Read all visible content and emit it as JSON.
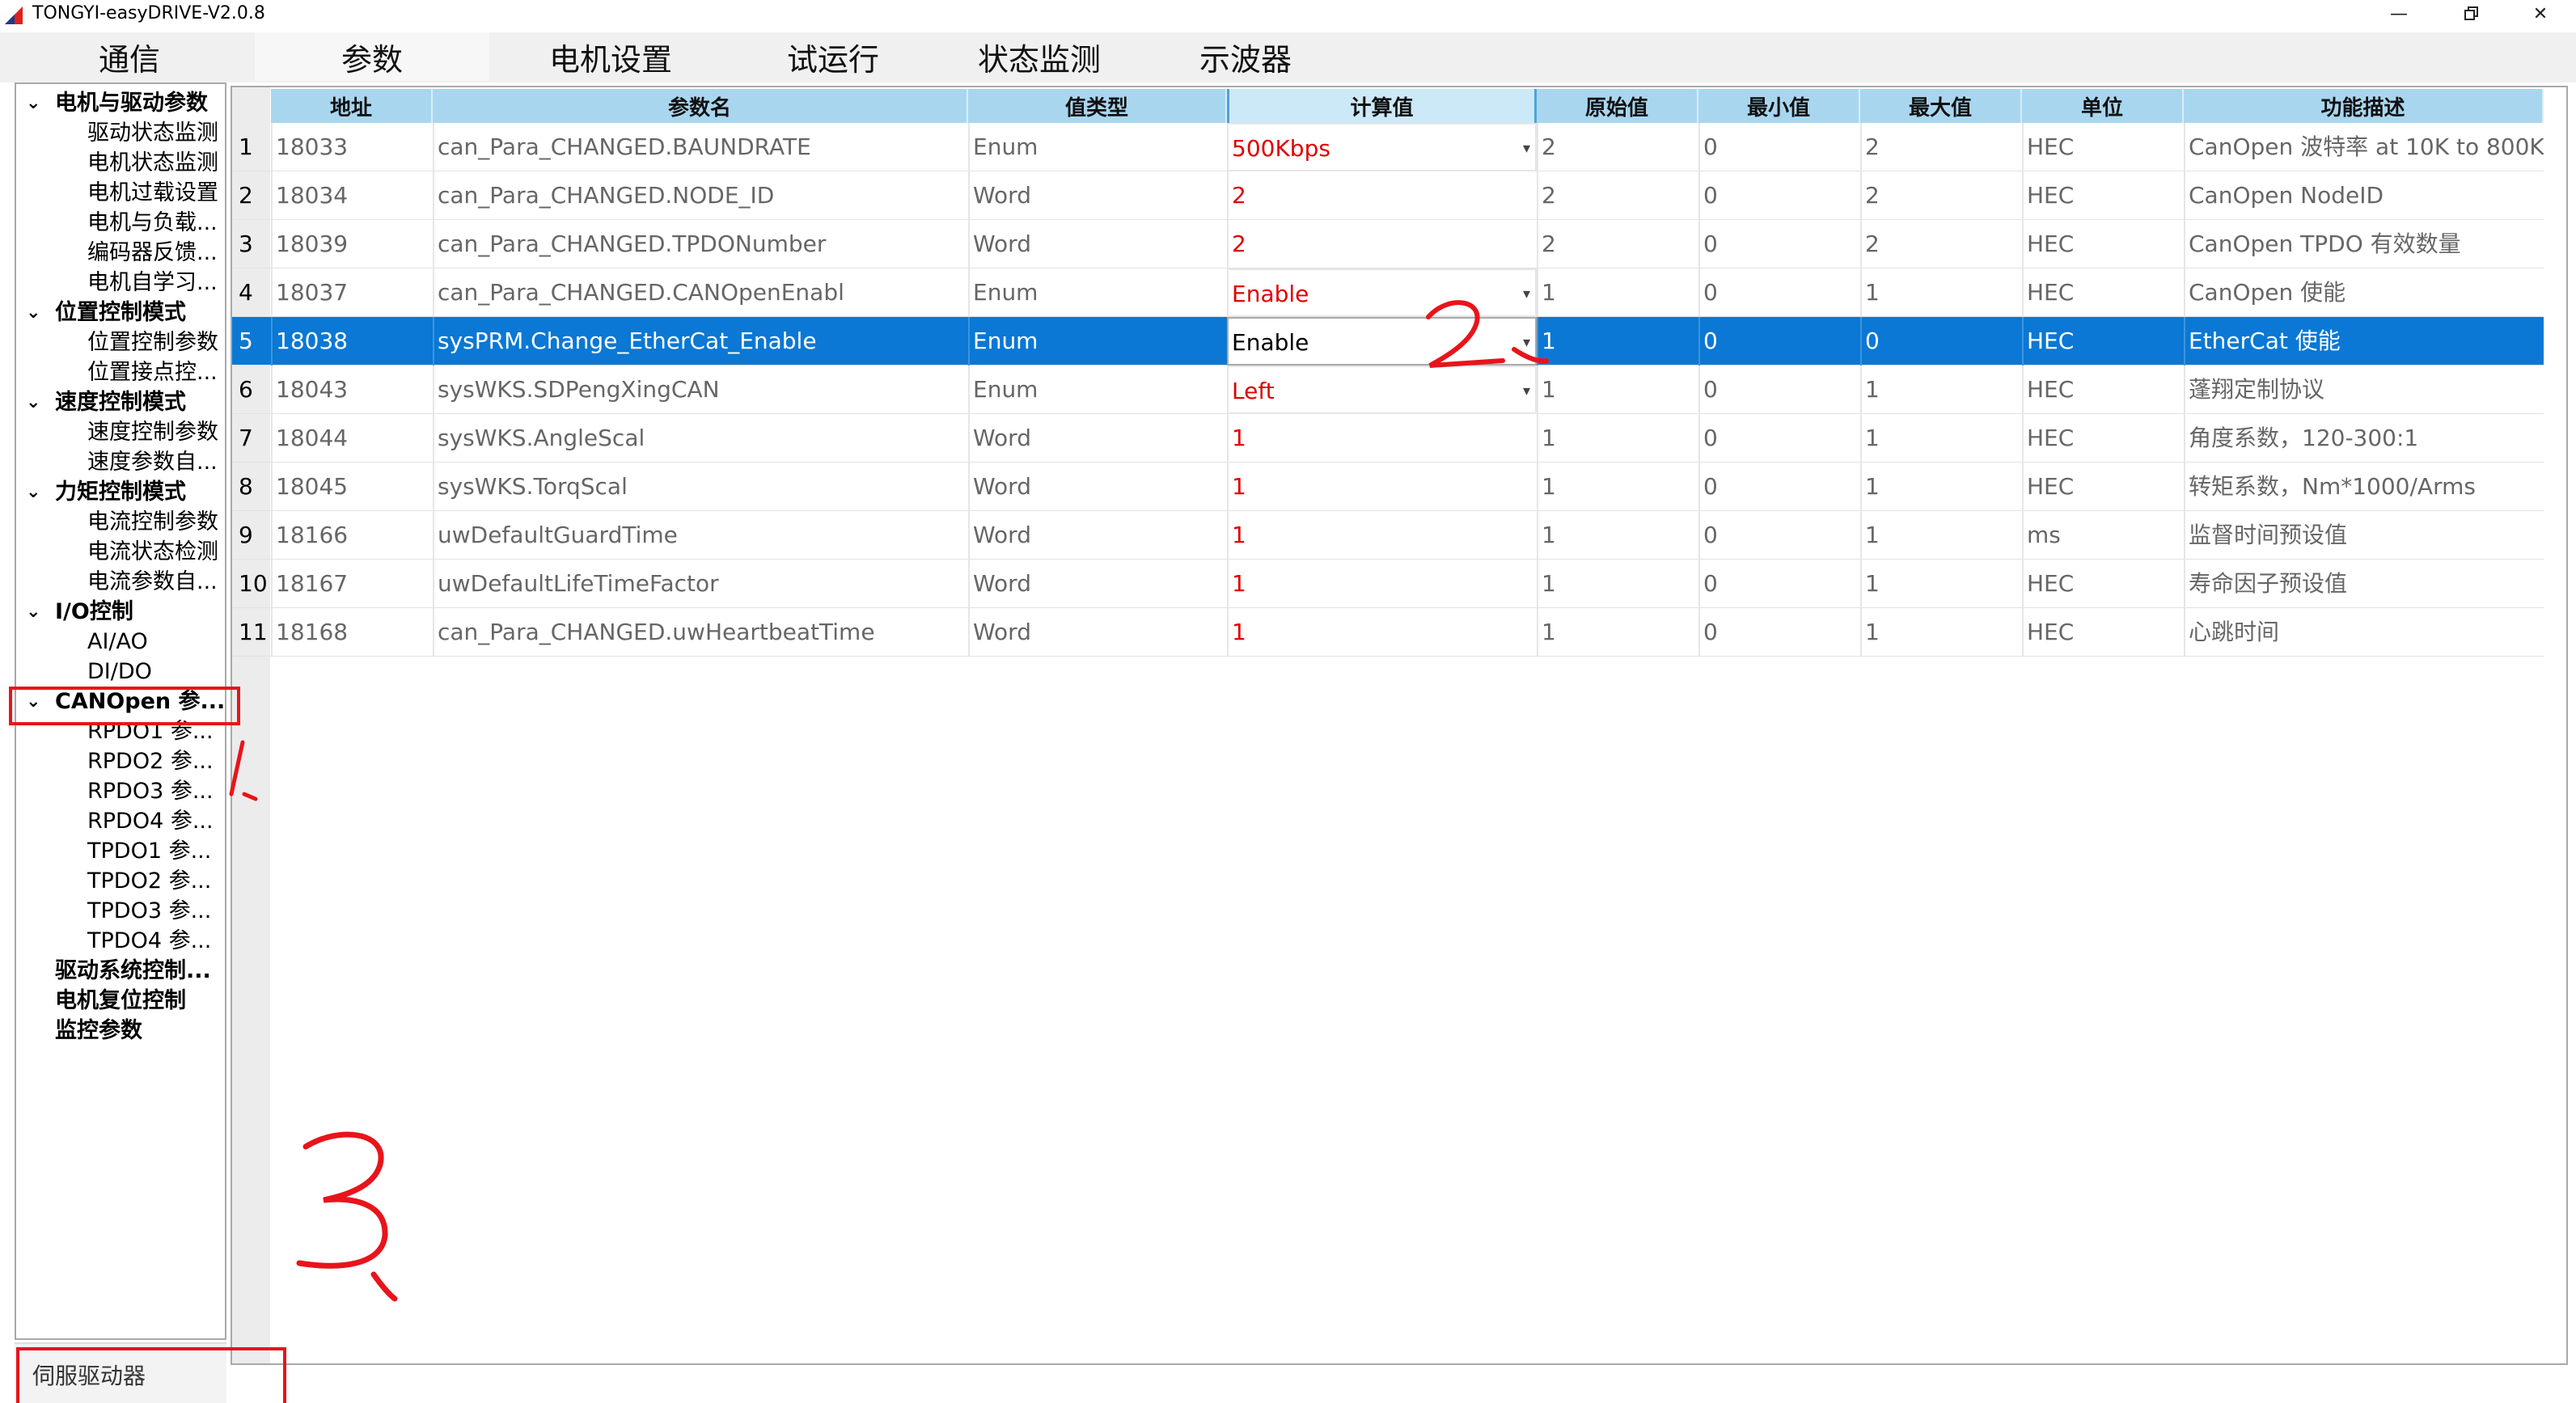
{
  "window": {
    "title": "TONGYI-easyDRIVE-V2.0.8"
  },
  "tabs": [
    "通信",
    "参数",
    "电机设置",
    "试运行",
    "状态监测",
    "示波器"
  ],
  "active_tab": "参数",
  "sidebar": {
    "items": [
      {
        "label": "电机与驱动参数",
        "group": true
      },
      {
        "label": "驱动状态监测"
      },
      {
        "label": "电机状态监测"
      },
      {
        "label": "电机过载设置"
      },
      {
        "label": "电机与负载..."
      },
      {
        "label": "编码器反馈..."
      },
      {
        "label": "电机自学习..."
      },
      {
        "label": "位置控制模式",
        "group": true
      },
      {
        "label": "位置控制参数"
      },
      {
        "label": "位置接点控..."
      },
      {
        "label": "速度控制模式",
        "group": true
      },
      {
        "label": "速度控制参数"
      },
      {
        "label": "速度参数自..."
      },
      {
        "label": "力矩控制模式",
        "group": true
      },
      {
        "label": "电流控制参数"
      },
      {
        "label": "电流状态检测"
      },
      {
        "label": "电流参数自..."
      },
      {
        "label": "I/O控制",
        "group": true
      },
      {
        "label": "AI/AO"
      },
      {
        "label": "DI/DO"
      },
      {
        "label": "CANOpen 参...",
        "group": true
      },
      {
        "label": "RPDO1 参..."
      },
      {
        "label": "RPDO2 参..."
      },
      {
        "label": "RPDO3 参..."
      },
      {
        "label": "RPDO4 参..."
      },
      {
        "label": "TPDO1 参..."
      },
      {
        "label": "TPDO2 参..."
      },
      {
        "label": "TPDO3 参..."
      },
      {
        "label": "TPDO4 参..."
      },
      {
        "label": "驱动系统控制...",
        "group": true
      },
      {
        "label": "电机复位控制",
        "group": true
      },
      {
        "label": "监控参数",
        "group": true
      }
    ],
    "footer": "伺服驱动器"
  },
  "table": {
    "headers": [
      "地址",
      "参数名",
      "值类型",
      "计算值",
      "原始值",
      "最小值",
      "最大值",
      "单位",
      "功能描述"
    ],
    "selected_row": 5,
    "rows": [
      {
        "n": "1",
        "addr": "18033",
        "name": "can_Para_CHANGED.BAUNDRATE",
        "type": "Enum",
        "calc": "500Kbps",
        "raw": "2",
        "min": "0",
        "max": "2",
        "unit": "HEC",
        "desc": "CanOpen 波特率 at 10K to 800K"
      },
      {
        "n": "2",
        "addr": "18034",
        "name": "can_Para_CHANGED.NODE_ID",
        "type": "Word",
        "calc": "2",
        "raw": "2",
        "min": "0",
        "max": "2",
        "unit": "HEC",
        "desc": "CanOpen NodeID"
      },
      {
        "n": "3",
        "addr": "18039",
        "name": "can_Para_CHANGED.TPDONumber",
        "type": "Word",
        "calc": "2",
        "raw": "2",
        "min": "0",
        "max": "2",
        "unit": "HEC",
        "desc": "CanOpen TPDO 有效数量"
      },
      {
        "n": "4",
        "addr": "18037",
        "name": "can_Para_CHANGED.CANOpenEnabl",
        "type": "Enum",
        "calc": "Enable",
        "raw": "1",
        "min": "0",
        "max": "1",
        "unit": "HEC",
        "desc": "CanOpen 使能"
      },
      {
        "n": "5",
        "addr": "18038",
        "name": "sysPRM.Change_EtherCat_Enable",
        "type": "Enum",
        "calc": "Enable",
        "raw": "1",
        "min": "0",
        "max": "0",
        "unit": "HEC",
        "desc": "EtherCat 使能"
      },
      {
        "n": "6",
        "addr": "18043",
        "name": "sysWKS.SDPengXingCAN",
        "type": "Enum",
        "calc": "Left",
        "raw": "1",
        "min": "0",
        "max": "1",
        "unit": "HEC",
        "desc": "蓬翔定制协议"
      },
      {
        "n": "7",
        "addr": "18044",
        "name": "sysWKS.AngleScal",
        "type": "Word",
        "calc": "1",
        "raw": "1",
        "min": "0",
        "max": "1",
        "unit": "HEC",
        "desc": "角度系数，120-300:1"
      },
      {
        "n": "8",
        "addr": "18045",
        "name": "sysWKS.TorqScal",
        "type": "Word",
        "calc": "1",
        "raw": "1",
        "min": "0",
        "max": "1",
        "unit": "HEC",
        "desc": "转矩系数，Nm*1000/Arms"
      },
      {
        "n": "9",
        "addr": "18166",
        "name": "uwDefaultGuardTime",
        "type": "Word",
        "calc": "1",
        "raw": "1",
        "min": "0",
        "max": "1",
        "unit": "ms",
        "desc": "监督时间预设值"
      },
      {
        "n": "10",
        "addr": "18167",
        "name": "uwDefaultLifeTimeFactor",
        "type": "Word",
        "calc": "1",
        "raw": "1",
        "min": "0",
        "max": "1",
        "unit": "HEC",
        "desc": "寿命因子预设值"
      },
      {
        "n": "11",
        "addr": "18168",
        "name": "can_Para_CHANGED.uwHeartbeatTime",
        "type": "Word",
        "calc": "1",
        "raw": "1",
        "min": "0",
        "max": "1",
        "unit": "HEC",
        "desc": "心跳时间"
      }
    ]
  },
  "annotations": {
    "color": "#e8141b"
  }
}
